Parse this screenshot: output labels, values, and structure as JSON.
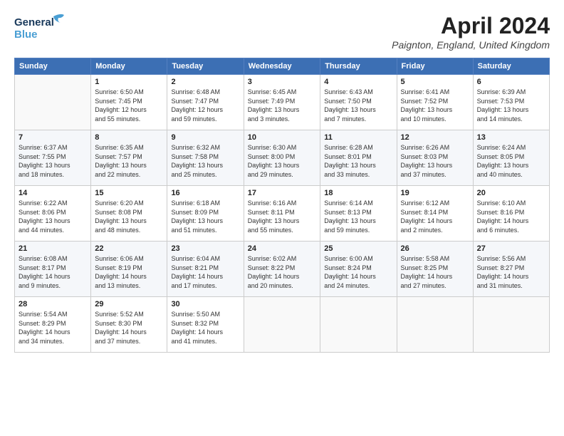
{
  "header": {
    "logo_general": "General",
    "logo_blue": "Blue",
    "title": "April 2024",
    "subtitle": "Paignton, England, United Kingdom"
  },
  "days_of_week": [
    "Sunday",
    "Monday",
    "Tuesday",
    "Wednesday",
    "Thursday",
    "Friday",
    "Saturday"
  ],
  "weeks": [
    [
      {
        "number": "",
        "info": ""
      },
      {
        "number": "1",
        "info": "Sunrise: 6:50 AM\nSunset: 7:45 PM\nDaylight: 12 hours\nand 55 minutes."
      },
      {
        "number": "2",
        "info": "Sunrise: 6:48 AM\nSunset: 7:47 PM\nDaylight: 12 hours\nand 59 minutes."
      },
      {
        "number": "3",
        "info": "Sunrise: 6:45 AM\nSunset: 7:49 PM\nDaylight: 13 hours\nand 3 minutes."
      },
      {
        "number": "4",
        "info": "Sunrise: 6:43 AM\nSunset: 7:50 PM\nDaylight: 13 hours\nand 7 minutes."
      },
      {
        "number": "5",
        "info": "Sunrise: 6:41 AM\nSunset: 7:52 PM\nDaylight: 13 hours\nand 10 minutes."
      },
      {
        "number": "6",
        "info": "Sunrise: 6:39 AM\nSunset: 7:53 PM\nDaylight: 13 hours\nand 14 minutes."
      }
    ],
    [
      {
        "number": "7",
        "info": "Sunrise: 6:37 AM\nSunset: 7:55 PM\nDaylight: 13 hours\nand 18 minutes."
      },
      {
        "number": "8",
        "info": "Sunrise: 6:35 AM\nSunset: 7:57 PM\nDaylight: 13 hours\nand 22 minutes."
      },
      {
        "number": "9",
        "info": "Sunrise: 6:32 AM\nSunset: 7:58 PM\nDaylight: 13 hours\nand 25 minutes."
      },
      {
        "number": "10",
        "info": "Sunrise: 6:30 AM\nSunset: 8:00 PM\nDaylight: 13 hours\nand 29 minutes."
      },
      {
        "number": "11",
        "info": "Sunrise: 6:28 AM\nSunset: 8:01 PM\nDaylight: 13 hours\nand 33 minutes."
      },
      {
        "number": "12",
        "info": "Sunrise: 6:26 AM\nSunset: 8:03 PM\nDaylight: 13 hours\nand 37 minutes."
      },
      {
        "number": "13",
        "info": "Sunrise: 6:24 AM\nSunset: 8:05 PM\nDaylight: 13 hours\nand 40 minutes."
      }
    ],
    [
      {
        "number": "14",
        "info": "Sunrise: 6:22 AM\nSunset: 8:06 PM\nDaylight: 13 hours\nand 44 minutes."
      },
      {
        "number": "15",
        "info": "Sunrise: 6:20 AM\nSunset: 8:08 PM\nDaylight: 13 hours\nand 48 minutes."
      },
      {
        "number": "16",
        "info": "Sunrise: 6:18 AM\nSunset: 8:09 PM\nDaylight: 13 hours\nand 51 minutes."
      },
      {
        "number": "17",
        "info": "Sunrise: 6:16 AM\nSunset: 8:11 PM\nDaylight: 13 hours\nand 55 minutes."
      },
      {
        "number": "18",
        "info": "Sunrise: 6:14 AM\nSunset: 8:13 PM\nDaylight: 13 hours\nand 59 minutes."
      },
      {
        "number": "19",
        "info": "Sunrise: 6:12 AM\nSunset: 8:14 PM\nDaylight: 14 hours\nand 2 minutes."
      },
      {
        "number": "20",
        "info": "Sunrise: 6:10 AM\nSunset: 8:16 PM\nDaylight: 14 hours\nand 6 minutes."
      }
    ],
    [
      {
        "number": "21",
        "info": "Sunrise: 6:08 AM\nSunset: 8:17 PM\nDaylight: 14 hours\nand 9 minutes."
      },
      {
        "number": "22",
        "info": "Sunrise: 6:06 AM\nSunset: 8:19 PM\nDaylight: 14 hours\nand 13 minutes."
      },
      {
        "number": "23",
        "info": "Sunrise: 6:04 AM\nSunset: 8:21 PM\nDaylight: 14 hours\nand 17 minutes."
      },
      {
        "number": "24",
        "info": "Sunrise: 6:02 AM\nSunset: 8:22 PM\nDaylight: 14 hours\nand 20 minutes."
      },
      {
        "number": "25",
        "info": "Sunrise: 6:00 AM\nSunset: 8:24 PM\nDaylight: 14 hours\nand 24 minutes."
      },
      {
        "number": "26",
        "info": "Sunrise: 5:58 AM\nSunset: 8:25 PM\nDaylight: 14 hours\nand 27 minutes."
      },
      {
        "number": "27",
        "info": "Sunrise: 5:56 AM\nSunset: 8:27 PM\nDaylight: 14 hours\nand 31 minutes."
      }
    ],
    [
      {
        "number": "28",
        "info": "Sunrise: 5:54 AM\nSunset: 8:29 PM\nDaylight: 14 hours\nand 34 minutes."
      },
      {
        "number": "29",
        "info": "Sunrise: 5:52 AM\nSunset: 8:30 PM\nDaylight: 14 hours\nand 37 minutes."
      },
      {
        "number": "30",
        "info": "Sunrise: 5:50 AM\nSunset: 8:32 PM\nDaylight: 14 hours\nand 41 minutes."
      },
      {
        "number": "",
        "info": ""
      },
      {
        "number": "",
        "info": ""
      },
      {
        "number": "",
        "info": ""
      },
      {
        "number": "",
        "info": ""
      }
    ]
  ]
}
